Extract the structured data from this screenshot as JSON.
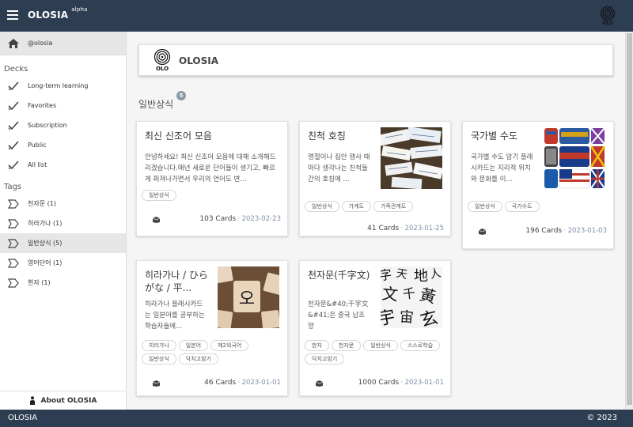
{
  "app": {
    "title": "OLOSIA",
    "badge": "alpha"
  },
  "sidebar": {
    "user": "@olosia",
    "decks_heading": "Decks",
    "decks": [
      {
        "label": "Long-term learning"
      },
      {
        "label": "Favorites"
      },
      {
        "label": "Subscription"
      },
      {
        "label": "Public"
      },
      {
        "label": "All list"
      }
    ],
    "tags_heading": "Tags",
    "tags": [
      {
        "label": "천자문 (1)"
      },
      {
        "label": "히라가나 (1)"
      },
      {
        "label": "일반상식 (5)",
        "active": true
      },
      {
        "label": "영어단어 (1)"
      },
      {
        "label": "한자 (1)"
      }
    ],
    "about": "About OLOSIA"
  },
  "main": {
    "header_title": "OLOSIA",
    "section_title": "일반상식",
    "section_count": "5",
    "cards": [
      {
        "title": "최신 신조어 모음",
        "desc": "안녕하세요! 최신 신조어 모음에 대해 소개해드리겠습니다.매년 새로운 단어들이 생기고, 빠르게 퍼져나가면서 우리의 언어도 변...",
        "tags": [
          "일반상식"
        ],
        "count": "103 Cards",
        "date": "· 2023-02-23"
      },
      {
        "title": "친척 호칭",
        "desc": "명절이나 집안 행사 때마다 생각나는 친척들간의 호칭에 ...",
        "tags": [
          "일반상식",
          "가계도",
          "가족관계도"
        ],
        "count": "41 Cards",
        "date": "· 2023-01-25"
      },
      {
        "title": "국가별 수도",
        "desc": "국가별 수도 암기 플래시카드는 지리적 위치와 문화를 이...",
        "tags": [
          "일반상식",
          "국가수도"
        ],
        "count": "196 Cards",
        "date": "· 2023-01-03"
      },
      {
        "title": "히라가나 / ひらがな / 平...",
        "desc": "히라가나 플래시카드는 일본어를 공부하는 학습자들에...",
        "tags": [
          "히라가나",
          "일본어",
          "제2외국어",
          "일반상식",
          "닥치고암기"
        ],
        "count": "46 Cards",
        "date": "· 2023-01-01"
      },
      {
        "title": "천자문(千字文)",
        "desc": "천자문&#40;千字文&#41;은 중국 남조 양&#40;502~549...",
        "tags": [
          "한자",
          "천자문",
          "일반상식",
          "스스로학습",
          "닥치고암기"
        ],
        "count": "1000 Cards",
        "date": "· 2023-01-01"
      }
    ]
  },
  "footer": {
    "left": "OLOSIA",
    "right": "© 2023"
  },
  "colors": {
    "bar": "#2e3e52",
    "accent": "#8090a8"
  }
}
